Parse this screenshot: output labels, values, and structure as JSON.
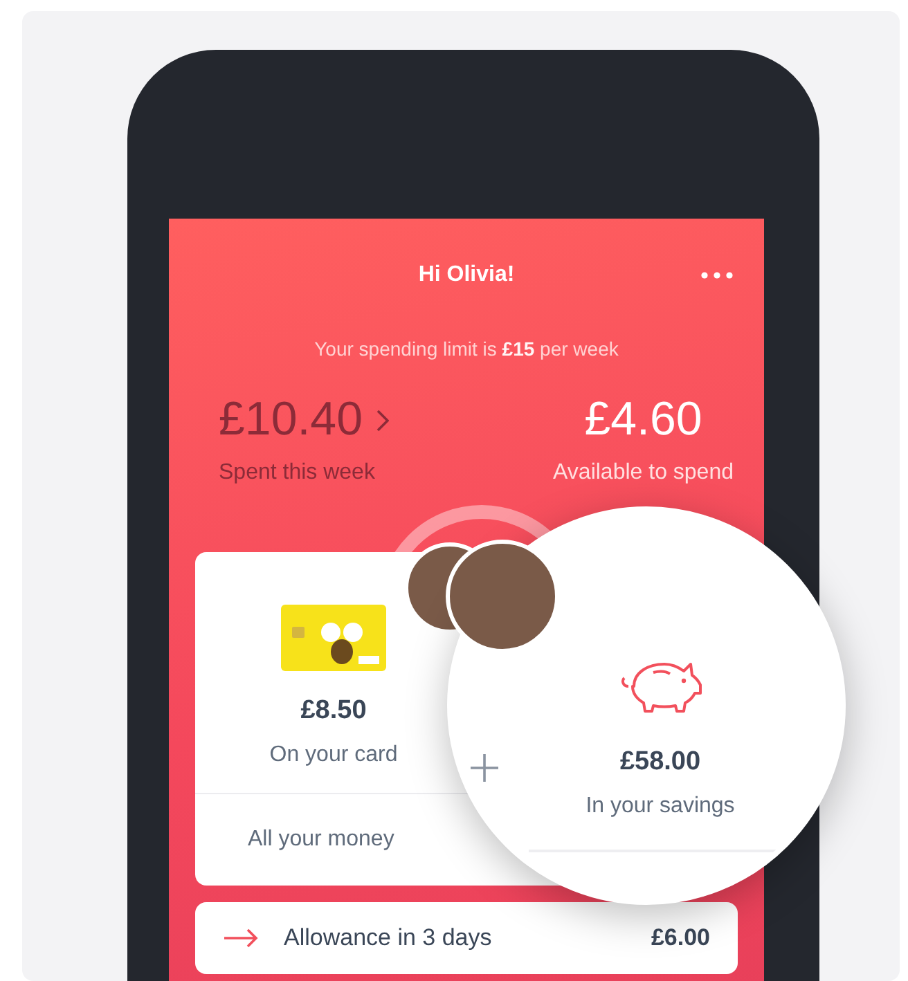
{
  "header": {
    "greeting": "Hi Olivia!"
  },
  "limit": "Your spending limit is **£15** per week",
  "summary": [
    {
      "kind": "spent",
      "amount": "£10.40",
      "label": "Spent this week"
    },
    {
      "kind": "available",
      "amount": "£4.60",
      "label": "Available to spend"
    }
  ],
  "balances": {
    "card": {
      "amount": "£8.50",
      "label": "On your card"
    },
    "savings": {
      "amount": "£58.00",
      "label": "In your savings"
    },
    "total_label": "All your money"
  },
  "upcoming": [
    {
      "label": "Allowance in 3 days",
      "amount": "£6.00"
    }
  ]
}
